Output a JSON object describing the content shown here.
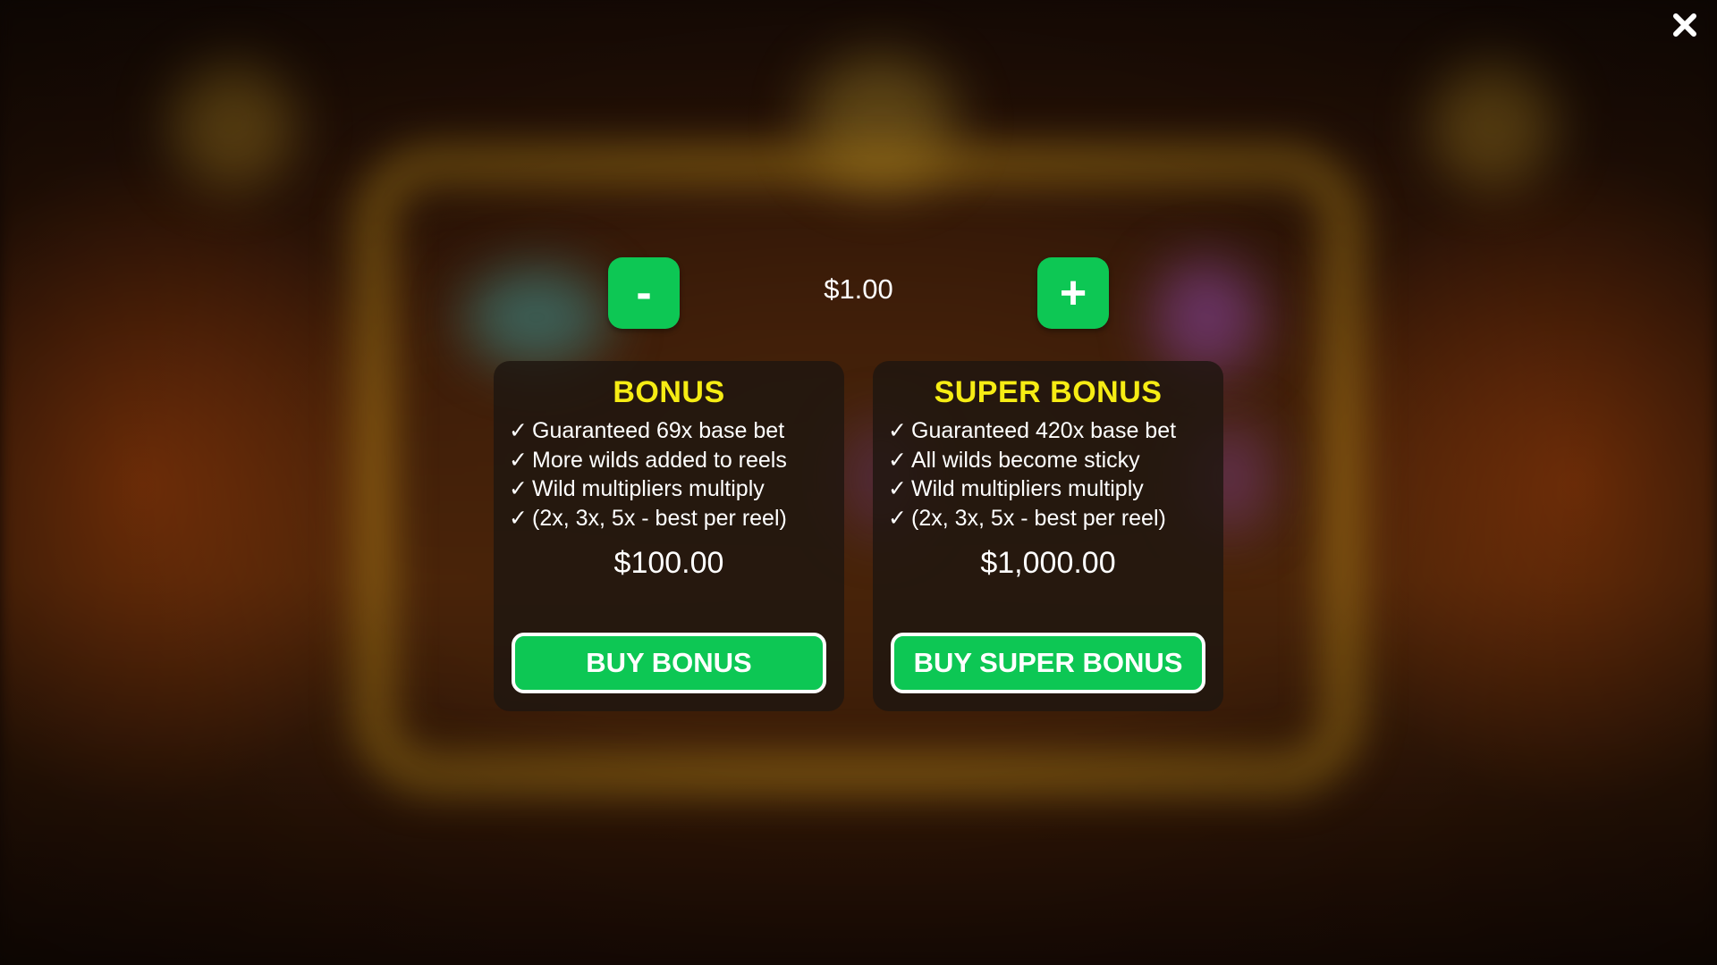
{
  "close": {
    "icon": "close-icon"
  },
  "bet": {
    "decrease_label": "-",
    "increase_label": "+",
    "value": "$1.00"
  },
  "offers": [
    {
      "title": "BONUS",
      "features": [
        "Guaranteed 69x base bet",
        "More wilds added to reels",
        "Wild multipliers multiply",
        "(2x, 3x, 5x - best per reel)"
      ],
      "price": "$100.00",
      "button_label": "BUY BONUS"
    },
    {
      "title": "SUPER BONUS",
      "features": [
        "Guaranteed 420x base bet",
        "All wilds become sticky",
        "Wild multipliers multiply",
        "(2x, 3x, 5x - best per reel)"
      ],
      "price": "$1,000.00",
      "button_label": "BUY SUPER BONUS"
    }
  ],
  "check_glyph": "✓",
  "colors": {
    "accent_green": "#0dc754",
    "title_yellow": "#f6ec14",
    "card_background": "#1e1610",
    "text": "#ffffff"
  }
}
